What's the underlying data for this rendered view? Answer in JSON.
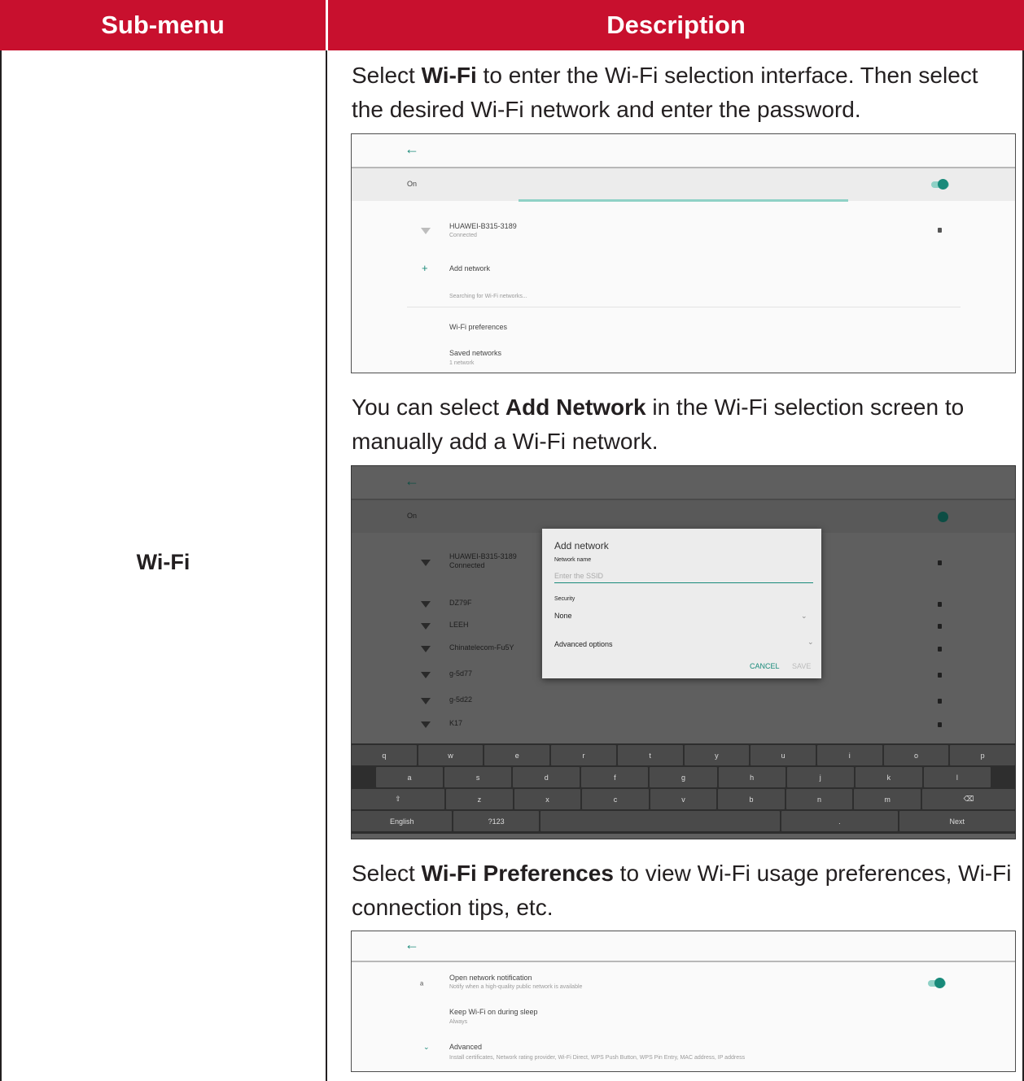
{
  "table": {
    "header_submenu": "Sub-menu",
    "header_description": "Description",
    "submenu_name": "Wi-Fi"
  },
  "colors": {
    "header_bg": "#c8102e",
    "accent": "#188a7a"
  },
  "para1": {
    "pre": "Select ",
    "bold": "Wi-Fi",
    "post": " to enter the Wi-Fi selection interface. Then select the desired Wi-Fi network and enter the password."
  },
  "para2": {
    "pre": "You can select ",
    "bold": "Add Network",
    "post": " in the Wi-Fi selection screen to manually add a Wi-Fi network."
  },
  "para3": {
    "pre": "Select ",
    "bold": "Wi-Fi Preferences",
    "post": " to view Wi-Fi usage preferences, Wi-Fi connection tips, etc."
  },
  "shot1": {
    "back_icon": "arrow-left-icon",
    "on_label": "On",
    "network_name": "HUAWEI-B315-3189",
    "network_status": "Connected",
    "add_network": "Add network",
    "searching": "Searching for Wi-Fi networks...",
    "preferences": "Wi-Fi preferences",
    "saved_networks": "Saved networks",
    "saved_count": "1 network"
  },
  "shot2": {
    "on_label": "On",
    "networks": [
      "HUAWEI-B315-3189",
      "DZ79F",
      "LEEH",
      "Chinatelecom-Fu5Y",
      "g-5d77",
      "g-5d22",
      "K17"
    ],
    "network_status": "Connected",
    "dialog_title": "Add network",
    "network_name_label": "Network name",
    "ssid_placeholder": "Enter the SSID",
    "security_label": "Security",
    "security_value": "None",
    "advanced_options": "Advanced options",
    "cancel": "CANCEL",
    "save": "SAVE",
    "keyboard_row1": [
      "q",
      "w",
      "e",
      "r",
      "t",
      "y",
      "u",
      "i",
      "o",
      "p"
    ],
    "keyboard_row2": [
      "a",
      "s",
      "d",
      "f",
      "g",
      "h",
      "j",
      "k",
      "l"
    ],
    "keyboard_row3": [
      "⇧",
      "z",
      "x",
      "c",
      "v",
      "b",
      "n",
      "m",
      "⌫"
    ],
    "keyboard_row4": [
      "English",
      "?123",
      "",
      ".",
      "Next"
    ]
  },
  "shot3": {
    "open_notif": "Open network notification",
    "open_notif_sub": "Notify when a high-quality public network is available",
    "keep_on": "Keep Wi-Fi on during sleep",
    "keep_on_sub": "Always",
    "advanced": "Advanced",
    "advanced_sub": "Install certificates, Network rating provider, Wi-Fi Direct, WPS Push Button, WPS Pin Entry, MAC address, IP address"
  }
}
